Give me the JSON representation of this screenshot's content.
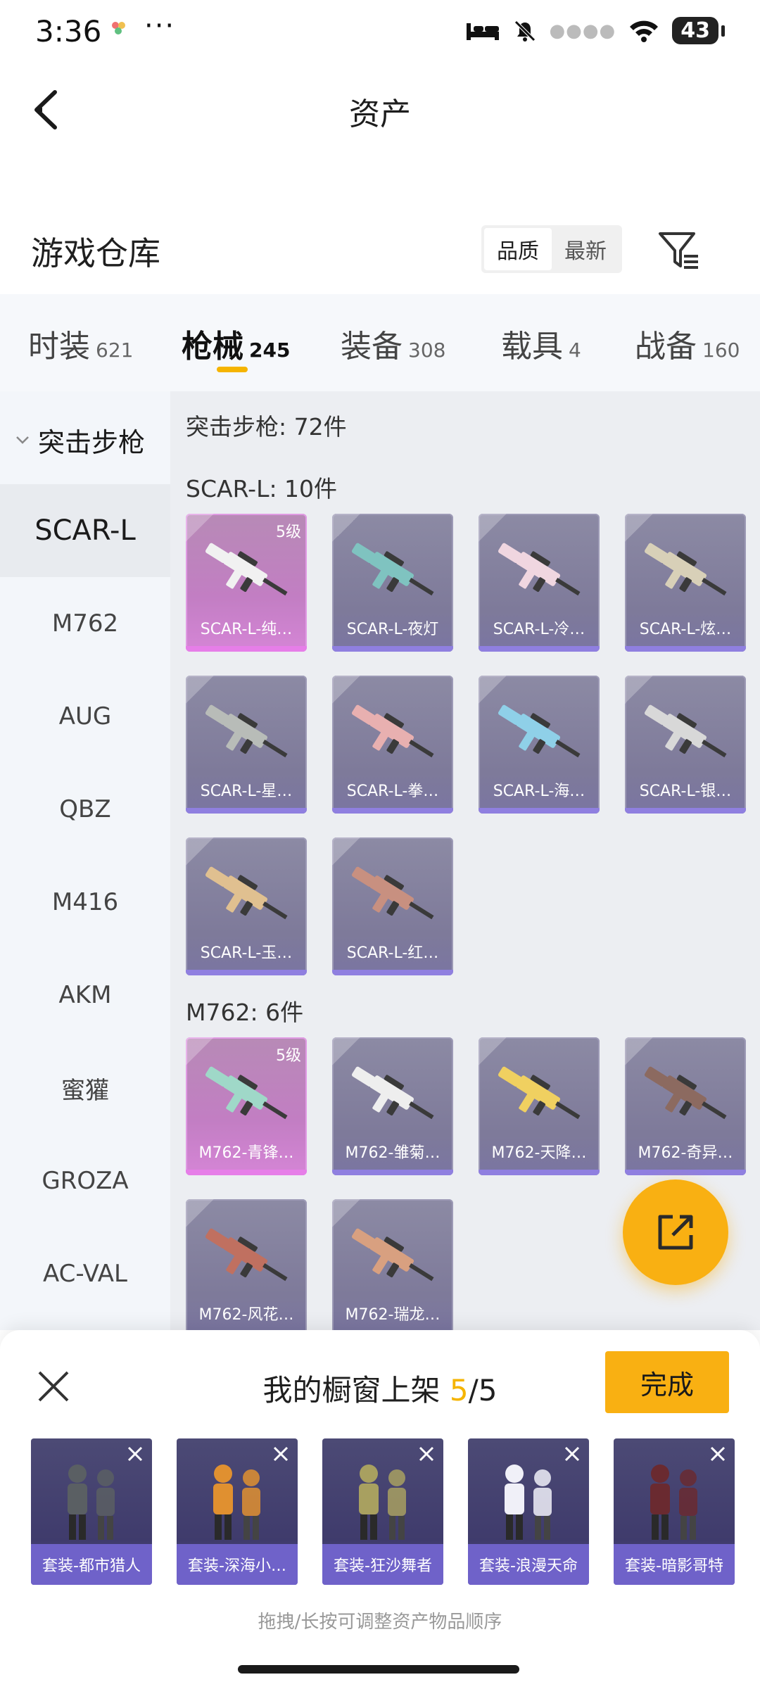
{
  "status_bar": {
    "time": "3:36",
    "more": "···",
    "battery": "43"
  },
  "header": {
    "title": "资产"
  },
  "warehouse": {
    "title": "游戏仓库",
    "sort_options": [
      "品质",
      "最新"
    ],
    "active_sort": "品质"
  },
  "tabs": [
    {
      "label": "时装",
      "count": "621"
    },
    {
      "label": "枪械",
      "count": "245"
    },
    {
      "label": "装备",
      "count": "308"
    },
    {
      "label": "载具",
      "count": "4"
    },
    {
      "label": "战备",
      "count": "160"
    }
  ],
  "active_tab": "枪械",
  "sidebar": {
    "group_label": "突击步枪",
    "items": [
      "SCAR-L",
      "M762",
      "AUG",
      "QBZ",
      "M416",
      "AKM",
      "蜜獾",
      "GROZA",
      "AC-VAL"
    ],
    "active_item": "SCAR-L"
  },
  "content": {
    "category_heading": "突击步枪: 72件",
    "groups": [
      {
        "heading": "SCAR-L: 10件",
        "items": [
          {
            "name": "SCAR-L-纯…",
            "tier": "5级",
            "gun_color": "#f1f1f1"
          },
          {
            "name": "SCAR-L-夜灯",
            "tier": "",
            "gun_color": "#7fc3c0"
          },
          {
            "name": "SCAR-L-冷…",
            "tier": "",
            "gun_color": "#f0d6e0"
          },
          {
            "name": "SCAR-L-炫…",
            "tier": "",
            "gun_color": "#d8d0b8"
          },
          {
            "name": "SCAR-L-星…",
            "tier": "",
            "gun_color": "#b8bcb8"
          },
          {
            "name": "SCAR-L-拳…",
            "tier": "",
            "gun_color": "#e8b0b0"
          },
          {
            "name": "SCAR-L-海…",
            "tier": "",
            "gun_color": "#8fd0e8"
          },
          {
            "name": "SCAR-L-银…",
            "tier": "",
            "gun_color": "#d8d8d8"
          },
          {
            "name": "SCAR-L-玉…",
            "tier": "",
            "gun_color": "#e0c090"
          },
          {
            "name": "SCAR-L-红…",
            "tier": "",
            "gun_color": "#c89080"
          }
        ]
      },
      {
        "heading": "M762: 6件",
        "items": [
          {
            "name": "M762-青锋…",
            "tier": "5级",
            "gun_color": "#9fd8c8"
          },
          {
            "name": "M762-雏菊…",
            "tier": "",
            "gun_color": "#eeeeee"
          },
          {
            "name": "M762-天降…",
            "tier": "",
            "gun_color": "#f0d060"
          },
          {
            "name": "M762-奇异…",
            "tier": "",
            "gun_color": "#8c6a60"
          },
          {
            "name": "M762-风花…",
            "tier": "",
            "gun_color": "#c07060"
          },
          {
            "name": "M762-瑞龙…",
            "tier": "",
            "gun_color": "#d8a080"
          }
        ]
      }
    ]
  },
  "showcase": {
    "title": "我的橱窗上架",
    "count": "5",
    "total": "/5",
    "done_label": "完成",
    "items": [
      {
        "name": "套装-都市猎人",
        "outfit_color": "#5a5f63"
      },
      {
        "name": "套装-深海小…",
        "outfit_color": "#e09030"
      },
      {
        "name": "套装-狂沙舞者",
        "outfit_color": "#a8a060"
      },
      {
        "name": "套装-浪漫天命",
        "outfit_color": "#f0f0f8"
      },
      {
        "name": "套装-暗影哥特",
        "outfit_color": "#6a2a30"
      }
    ],
    "hint": "拖拽/长按可调整资产物品顺序"
  },
  "colors": {
    "accent": "#f9b012",
    "legend_card": "#c27ec3",
    "epic_card": "#7e7a9a"
  }
}
